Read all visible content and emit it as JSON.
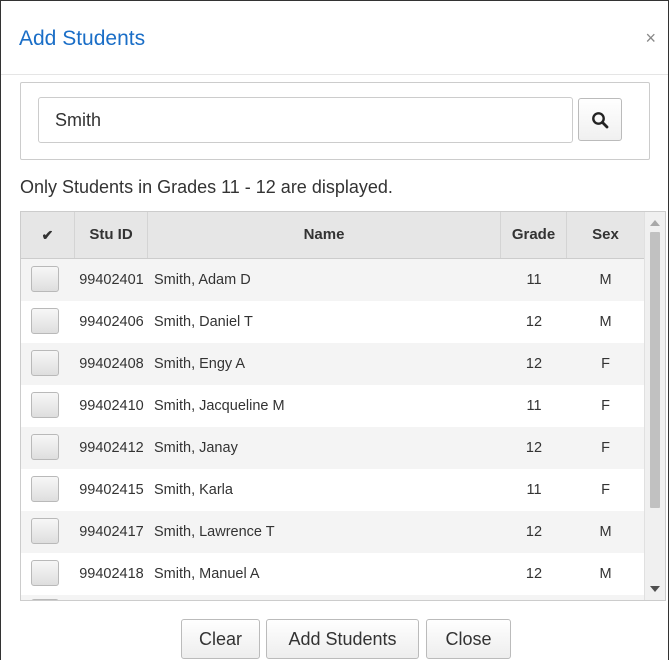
{
  "dialog": {
    "title": "Add Students",
    "close_glyph": "×"
  },
  "search": {
    "value": "Smith",
    "button_icon": "search-icon"
  },
  "info_text": "Only Students in Grades 11 - 12 are displayed.",
  "table": {
    "columns": {
      "select": "✔",
      "stu_id": "Stu ID",
      "name": "Name",
      "grade": "Grade",
      "sex": "Sex"
    },
    "rows": [
      {
        "stu_id": "99402401",
        "name": "Smith, Adam D",
        "grade": "11",
        "sex": "M"
      },
      {
        "stu_id": "99402406",
        "name": "Smith, Daniel T",
        "grade": "12",
        "sex": "M"
      },
      {
        "stu_id": "99402408",
        "name": "Smith, Engy A",
        "grade": "12",
        "sex": "F"
      },
      {
        "stu_id": "99402410",
        "name": "Smith, Jacqueline M",
        "grade": "11",
        "sex": "F"
      },
      {
        "stu_id": "99402412",
        "name": "Smith, Janay",
        "grade": "12",
        "sex": "F"
      },
      {
        "stu_id": "99402415",
        "name": "Smith, Karla",
        "grade": "11",
        "sex": "F"
      },
      {
        "stu_id": "99402417",
        "name": "Smith, Lawrence T",
        "grade": "12",
        "sex": "M"
      },
      {
        "stu_id": "99402418",
        "name": "Smith, Manuel A",
        "grade": "12",
        "sex": "M"
      }
    ]
  },
  "buttons": {
    "clear": "Clear",
    "add": "Add Students",
    "close": "Close"
  },
  "colors": {
    "title": "#1a6ec7",
    "header_bg": "#e6e6e6",
    "row_stripe": "#f4f4f4"
  }
}
